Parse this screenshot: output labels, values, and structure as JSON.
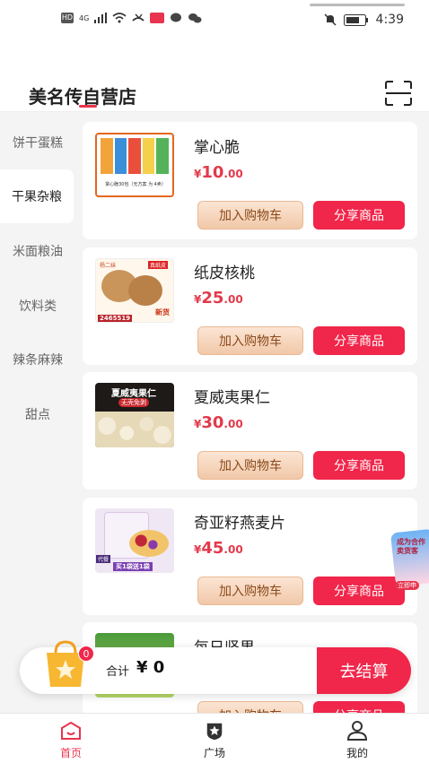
{
  "status_bar": {
    "time": "4:39",
    "network": "4G"
  },
  "header": {
    "shop_name": "美名传自营店"
  },
  "sidebar": {
    "items": [
      {
        "label": "饼干蛋糕",
        "active": false
      },
      {
        "label": "干果杂粮",
        "active": true
      },
      {
        "label": "米面粮油",
        "active": false
      },
      {
        "label": "饮料类",
        "active": false
      },
      {
        "label": "辣条麻辣",
        "active": false
      },
      {
        "label": "甜点",
        "active": false
      }
    ]
  },
  "products": [
    {
      "name": "掌心脆",
      "currency": "¥",
      "price_int": "10",
      "price_dec": ".00",
      "cart_label": "加入购物车",
      "share_label": "分享商品"
    },
    {
      "name": "纸皮核桃",
      "currency": "¥",
      "price_int": "25",
      "price_dec": ".00",
      "cart_label": "加入购物车",
      "share_label": "分享商品"
    },
    {
      "name": "夏威夷果仁",
      "currency": "¥",
      "price_int": "30",
      "price_dec": ".00",
      "cart_label": "加入购物车",
      "share_label": "分享商品"
    },
    {
      "name": "奇亚籽燕麦片",
      "currency": "¥",
      "price_int": "45",
      "price_dec": ".00",
      "cart_label": "加入购物车",
      "share_label": "分享商品"
    },
    {
      "name": "每日坚果",
      "currency": "¥",
      "price_int": "",
      "price_dec": "",
      "cart_label": "加入购物车",
      "share_label": "分享商品"
    }
  ],
  "product_image_text": {
    "p1_caption": "掌心脆30包（无方案 为 4卖）",
    "p2_brand": "杨二妹",
    "p2_tag": "真纸皮",
    "p2_new": "新货",
    "p2_sales": "2465519",
    "p3_title": "夏威夷果仁",
    "p3_sub": "无壳免剥",
    "p4_promo": "买1袋送1袋",
    "p4_tag": "代餐"
  },
  "float_badge": {
    "text": "成为合作卖货客",
    "sub": "立即申"
  },
  "cart": {
    "count": "0",
    "total_label": "合计",
    "total_amount": "¥ 0",
    "checkout_label": "去结算"
  },
  "tabbar": {
    "items": [
      {
        "label": "首页",
        "icon": "home-icon",
        "active": true
      },
      {
        "label": "广场",
        "icon": "star-shield-icon",
        "active": false
      },
      {
        "label": "我的",
        "icon": "user-icon",
        "active": false
      }
    ]
  },
  "colors": {
    "accent": "#f0264a",
    "price": "#e23a4c",
    "cart_btn": "#f1c8a8"
  }
}
